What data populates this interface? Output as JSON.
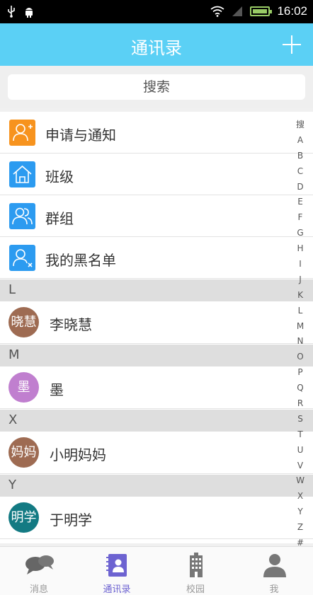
{
  "status_bar": {
    "time": "16:02"
  },
  "header": {
    "title": "通讯录"
  },
  "search": {
    "placeholder": "搜索"
  },
  "menu_items": [
    {
      "label": "申请与通知",
      "icon": "add-user-icon",
      "color": "#f7931e"
    },
    {
      "label": "班级",
      "icon": "home-icon",
      "color": "#2c9bf0"
    },
    {
      "label": "群组",
      "icon": "group-icon",
      "color": "#2c9bf0"
    },
    {
      "label": "我的黑名单",
      "icon": "block-user-icon",
      "color": "#2c9bf0"
    }
  ],
  "sections": [
    {
      "letter": "L",
      "contacts": [
        {
          "avatar_text": "晓慧",
          "name": "李晓慧",
          "color": "#9e6b52"
        }
      ]
    },
    {
      "letter": "M",
      "contacts": [
        {
          "avatar_text": "墨",
          "name": "墨",
          "color": "#c07fcf"
        }
      ]
    },
    {
      "letter": "X",
      "contacts": [
        {
          "avatar_text": "妈妈",
          "name": "小明妈妈",
          "color": "#9e6b52"
        }
      ]
    },
    {
      "letter": "Y",
      "contacts": [
        {
          "avatar_text": "明学",
          "name": "于明学",
          "color": "#137a83"
        }
      ]
    }
  ],
  "index_letters": [
    "搜",
    "A",
    "B",
    "C",
    "D",
    "E",
    "F",
    "G",
    "H",
    "I",
    "J",
    "K",
    "L",
    "M",
    "N",
    "O",
    "P",
    "Q",
    "R",
    "S",
    "T",
    "U",
    "V",
    "W",
    "X",
    "Y",
    "Z",
    "#"
  ],
  "bottom_nav": [
    {
      "label": "消息",
      "icon": "chat-bubbles-icon",
      "active": false
    },
    {
      "label": "通讯录",
      "icon": "contacts-book-icon",
      "active": true
    },
    {
      "label": "校园",
      "icon": "building-icon",
      "active": false
    },
    {
      "label": "我",
      "icon": "person-icon",
      "active": false
    }
  ],
  "colors": {
    "header": "#5bd0f5",
    "active_tab": "#6d63d1"
  }
}
